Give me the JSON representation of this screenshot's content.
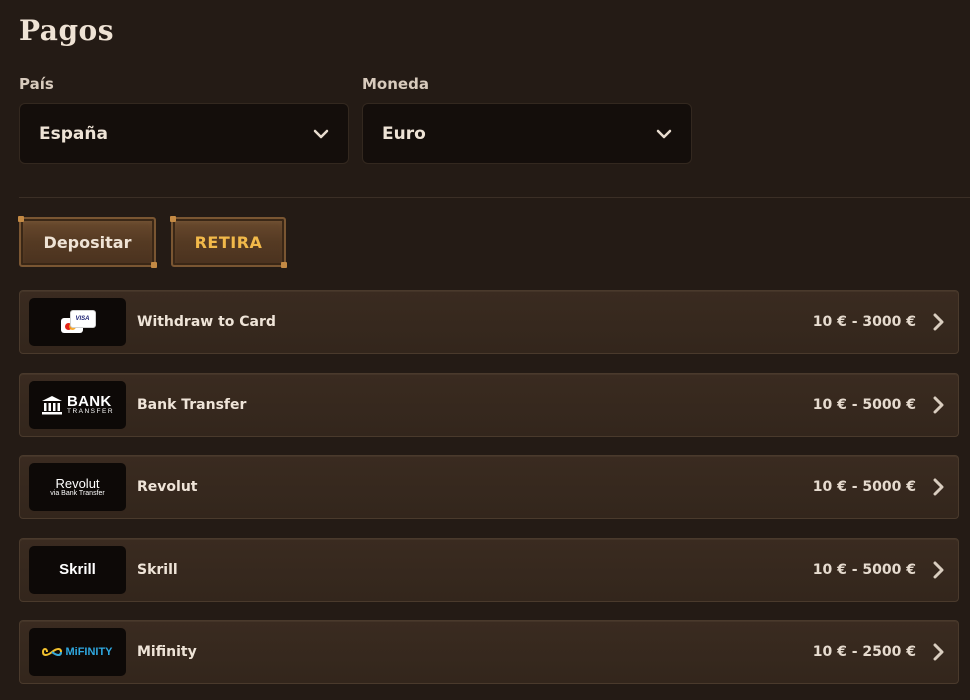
{
  "page": {
    "title": "Pagos"
  },
  "filters": {
    "country": {
      "label": "País",
      "value": "España"
    },
    "currency": {
      "label": "Moneda",
      "value": "Euro"
    }
  },
  "tabs": [
    {
      "label": "Depositar",
      "active": false
    },
    {
      "label": "RETIRA",
      "active": true
    }
  ],
  "methods": [
    {
      "name": "Withdraw to Card",
      "range": "10 € - 3000 €",
      "logo": "card-logo",
      "logo_text": "VISA"
    },
    {
      "name": "Bank Transfer",
      "range": "10 € - 5000 €",
      "logo": "bank-transfer-logo",
      "logo_text": "BANK",
      "logo_subtext": "TRANSFER"
    },
    {
      "name": "Revolut",
      "range": "10 € - 5000 €",
      "logo": "revolut-logo",
      "logo_text": "Revolut",
      "logo_subtext": "via Bank Transfer"
    },
    {
      "name": "Skrill",
      "range": "10 € - 5000 €",
      "logo": "skrill-logo",
      "logo_text": "Skrill"
    },
    {
      "name": "Mifinity",
      "range": "10 € - 2500 €",
      "logo": "mifinity-logo",
      "logo_text": "MiFINITY"
    }
  ],
  "colors": {
    "background": "#241b15",
    "accent": "#f2b94a",
    "row": "#3a2b20",
    "logo_bg": "#0d0907"
  }
}
